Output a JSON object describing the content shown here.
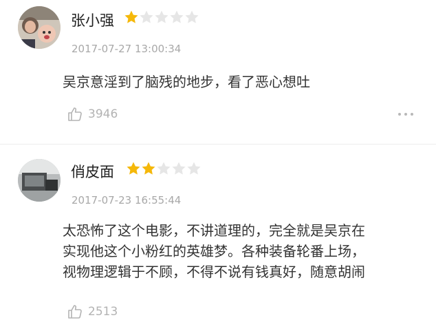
{
  "comments": [
    {
      "username": "张小强",
      "rating": 1,
      "timestamp": "2017-07-27 13:00:34",
      "content": "吴京意淫到了脑残的地步，看了恶心想吐",
      "likes": "3946"
    },
    {
      "username": "俏皮面",
      "rating": 2,
      "timestamp": "2017-07-23 16:55:44",
      "content_lines": [
        "太恐怖了这个电影，不讲道理的，完全就是吴京在",
        "实现他这个小粉红的英雄梦。各种装备轮番上场，",
        "视物理逻辑于不顾，不得不说有钱真好，随意胡闹"
      ],
      "likes": "2513"
    }
  ],
  "colors": {
    "star_filled": "#f5b80a",
    "star_empty": "#e6e6e6",
    "muted_text": "#a8a8a8"
  },
  "icons": [
    "thumbs-up-icon",
    "more-icon",
    "star-icon"
  ]
}
